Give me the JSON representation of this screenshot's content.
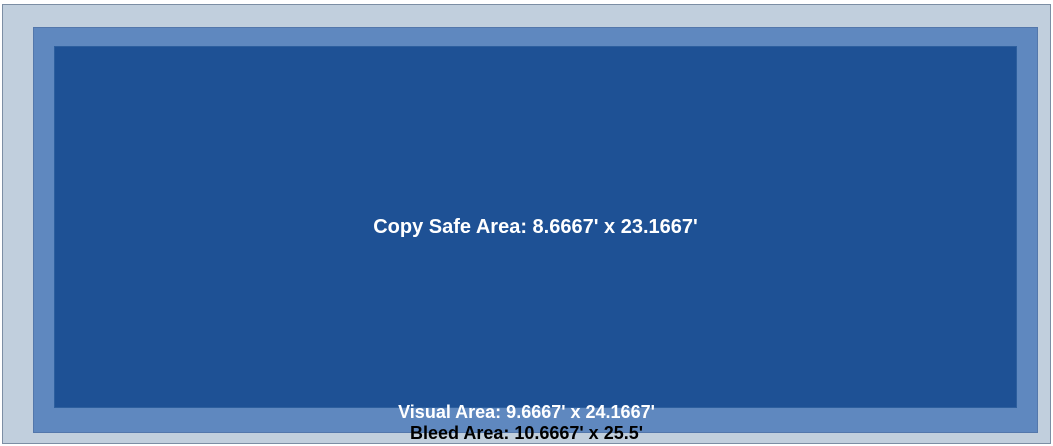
{
  "areas": {
    "copy_safe_label": "Copy Safe Area: 8.6667' x 23.1667'",
    "visual_label": "Visual Area: 9.6667' x 24.1667'",
    "bleed_label": "Bleed Area: 10.6667' x 25.5'"
  },
  "colors": {
    "bleed_fill": "#c1cfdd",
    "visual_fill": "#5f88bf",
    "copy_safe_fill": "#1e5195"
  }
}
